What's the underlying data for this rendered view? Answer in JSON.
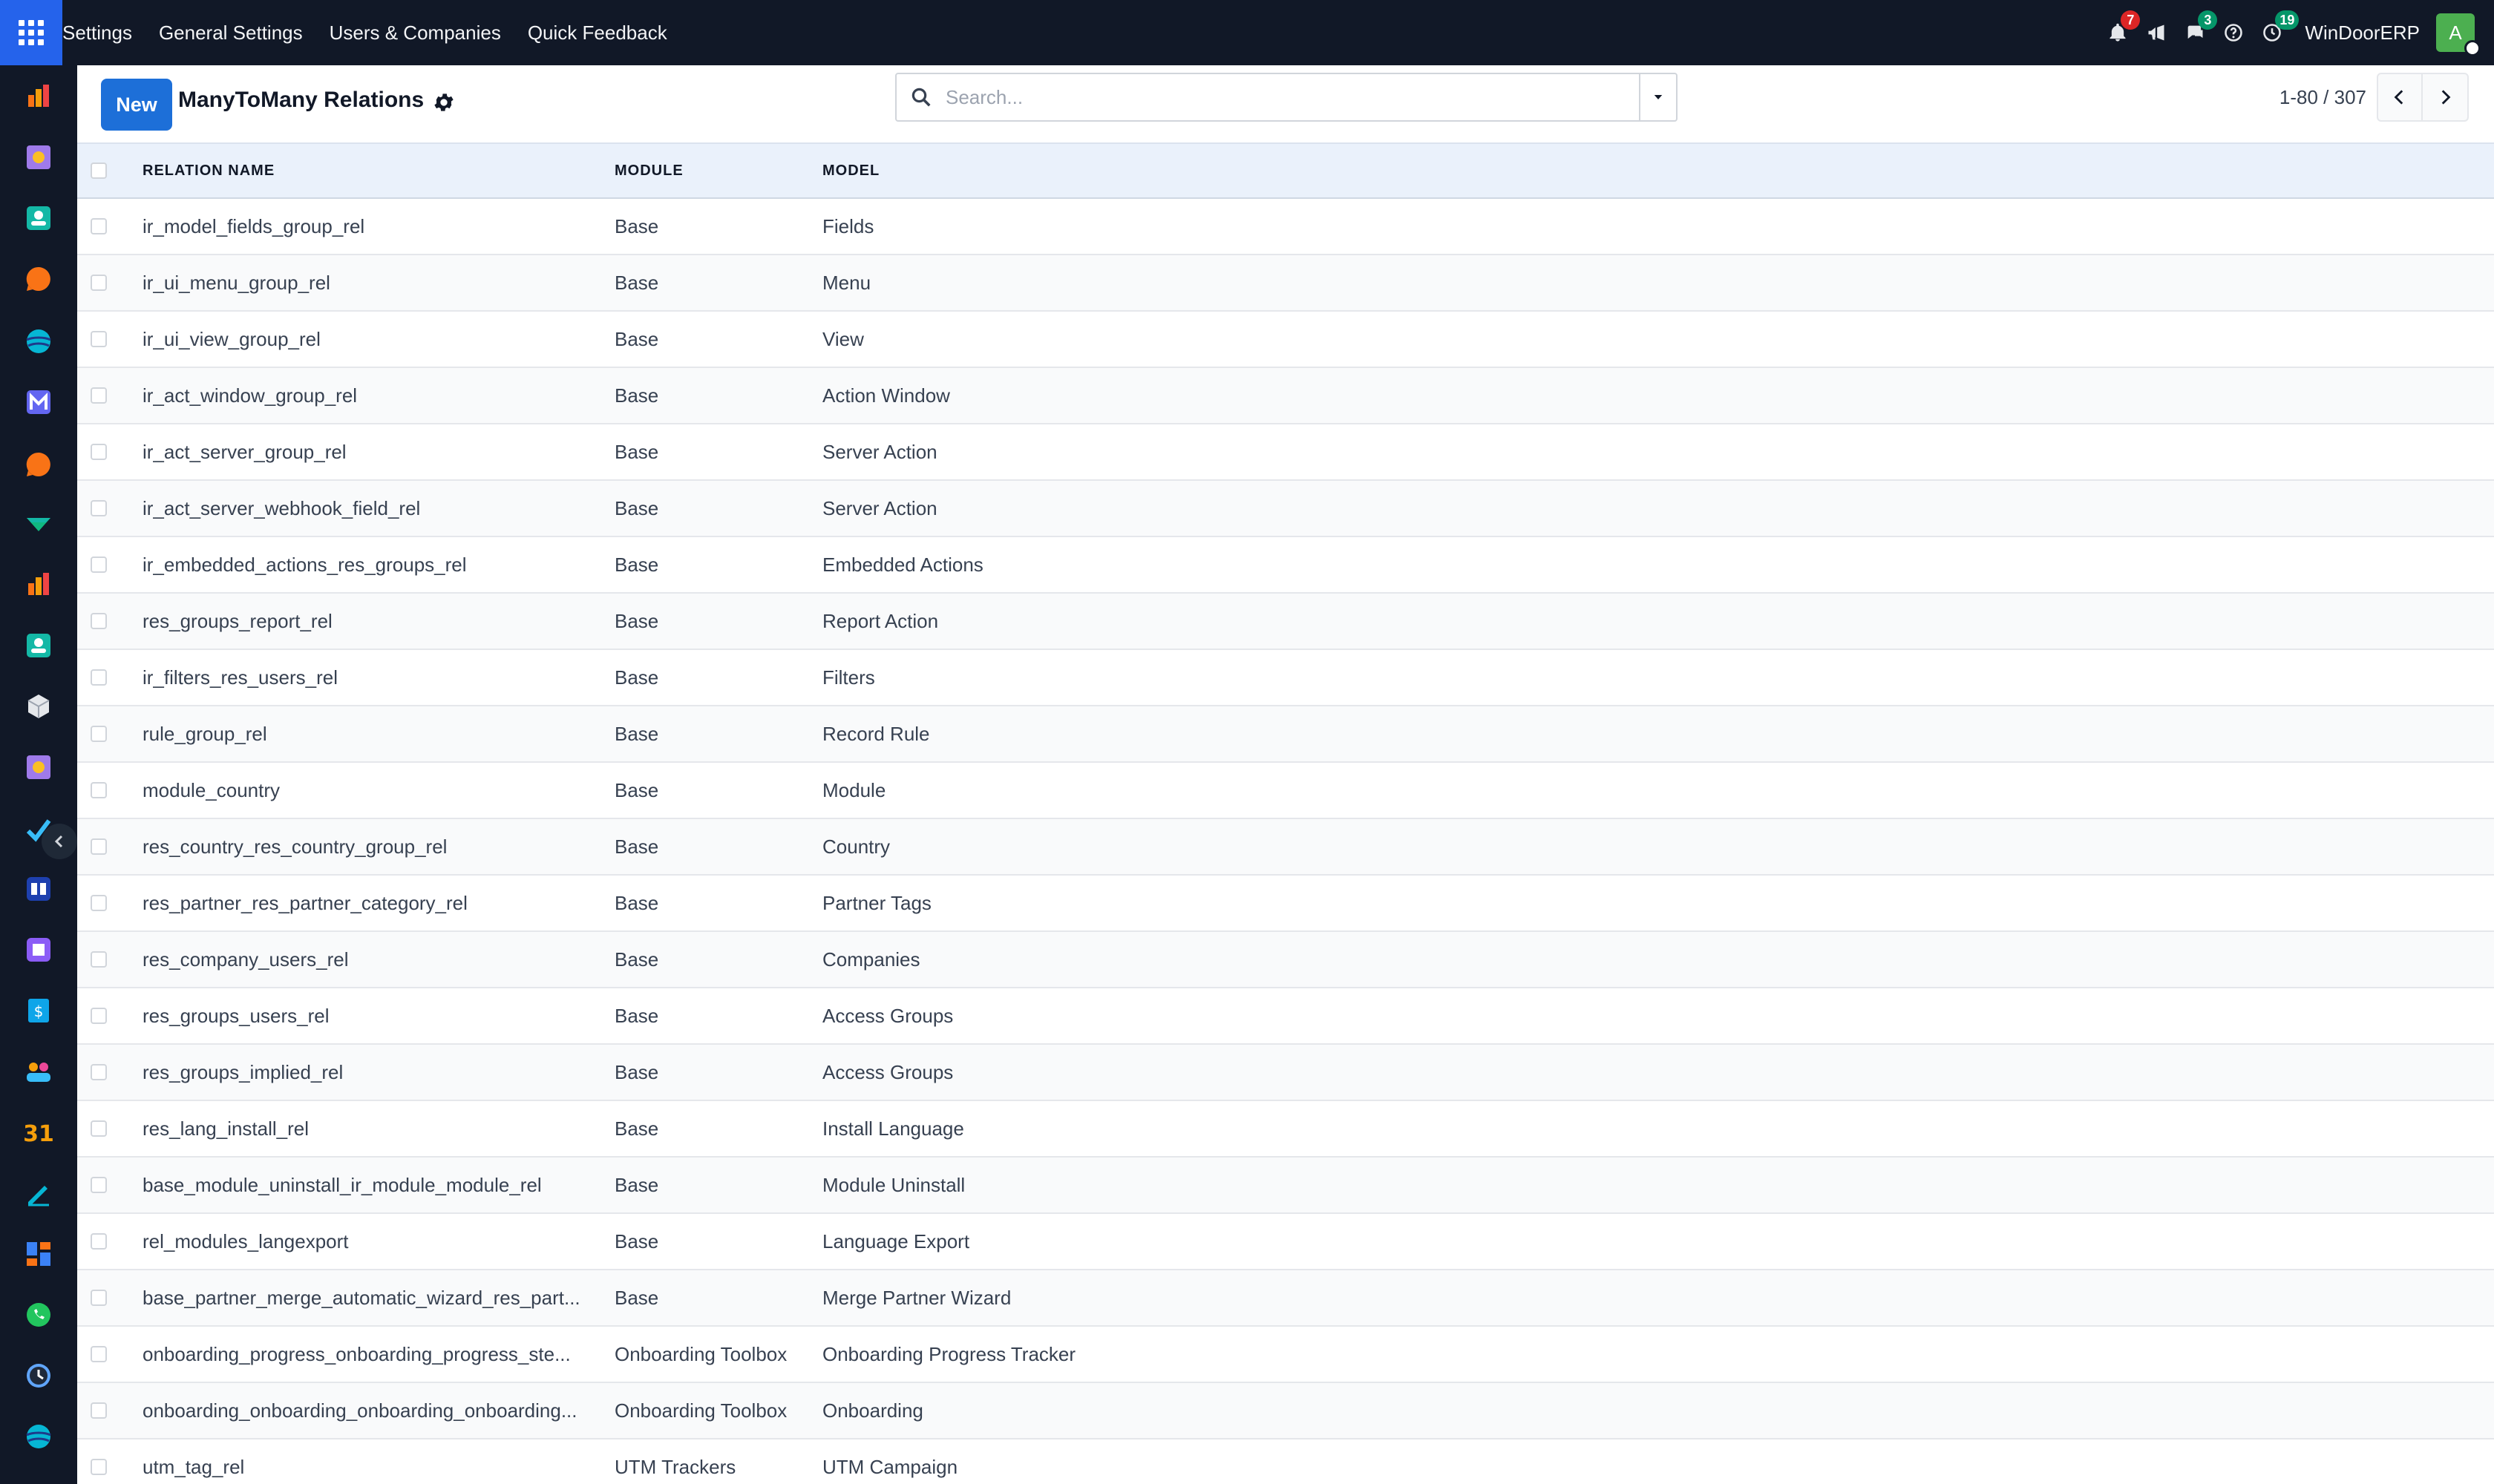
{
  "navbar": {
    "brand": "Settings",
    "menu": [
      "General Settings",
      "Users & Companies",
      "Quick Feedback"
    ],
    "badges": {
      "notifications": "7",
      "messages": "3",
      "activities": "19"
    },
    "company": "WinDoorERP",
    "avatar_initial": "A"
  },
  "control_panel": {
    "new_label": "New",
    "title": "ManyToMany Relations",
    "search_placeholder": "Search...",
    "pager_value": "1-80 / 307"
  },
  "table": {
    "headers": {
      "name": "RELATION NAME",
      "module": "MODULE",
      "model": "MODEL"
    },
    "rows": [
      {
        "name": "ir_model_fields_group_rel",
        "module": "Base",
        "model": "Fields"
      },
      {
        "name": "ir_ui_menu_group_rel",
        "module": "Base",
        "model": "Menu"
      },
      {
        "name": "ir_ui_view_group_rel",
        "module": "Base",
        "model": "View"
      },
      {
        "name": "ir_act_window_group_rel",
        "module": "Base",
        "model": "Action Window"
      },
      {
        "name": "ir_act_server_group_rel",
        "module": "Base",
        "model": "Server Action"
      },
      {
        "name": "ir_act_server_webhook_field_rel",
        "module": "Base",
        "model": "Server Action"
      },
      {
        "name": "ir_embedded_actions_res_groups_rel",
        "module": "Base",
        "model": "Embedded Actions"
      },
      {
        "name": "res_groups_report_rel",
        "module": "Base",
        "model": "Report Action"
      },
      {
        "name": "ir_filters_res_users_rel",
        "module": "Base",
        "model": "Filters"
      },
      {
        "name": "rule_group_rel",
        "module": "Base",
        "model": "Record Rule"
      },
      {
        "name": "module_country",
        "module": "Base",
        "model": "Module"
      },
      {
        "name": "res_country_res_country_group_rel",
        "module": "Base",
        "model": "Country"
      },
      {
        "name": "res_partner_res_partner_category_rel",
        "module": "Base",
        "model": "Partner Tags"
      },
      {
        "name": "res_company_users_rel",
        "module": "Base",
        "model": "Companies"
      },
      {
        "name": "res_groups_users_rel",
        "module": "Base",
        "model": "Access Groups"
      },
      {
        "name": "res_groups_implied_rel",
        "module": "Base",
        "model": "Access Groups"
      },
      {
        "name": "res_lang_install_rel",
        "module": "Base",
        "model": "Install Language"
      },
      {
        "name": "base_module_uninstall_ir_module_module_rel",
        "module": "Base",
        "model": "Module Uninstall"
      },
      {
        "name": "rel_modules_langexport",
        "module": "Base",
        "model": "Language Export"
      },
      {
        "name": "base_partner_merge_automatic_wizard_res_part...",
        "module": "Base",
        "model": "Merge Partner Wizard"
      },
      {
        "name": "onboarding_progress_onboarding_progress_ste...",
        "module": "Onboarding Toolbox",
        "model": "Onboarding Progress Tracker"
      },
      {
        "name": "onboarding_onboarding_onboarding_onboarding...",
        "module": "Onboarding Toolbox",
        "model": "Onboarding"
      },
      {
        "name": "utm_tag_rel",
        "module": "UTM Trackers",
        "model": "UTM Campaign"
      }
    ]
  },
  "sidebar_apps": [
    "sales-icon",
    "discuss-icon",
    "contacts-icon",
    "livechat-icon",
    "website-icon",
    "email-marketing-icon",
    "livechat-icon",
    "project-icon",
    "reporting-icon",
    "contacts-icon",
    "inventory-icon",
    "discuss-icon",
    "todo-icon",
    "knowledge-icon",
    "purchase-icon",
    "invoicing-icon",
    "employees-icon",
    "calendar-icon",
    "sign-icon",
    "dashboard-icon",
    "whatsapp-icon",
    "timesheet-icon",
    "website-icon"
  ]
}
